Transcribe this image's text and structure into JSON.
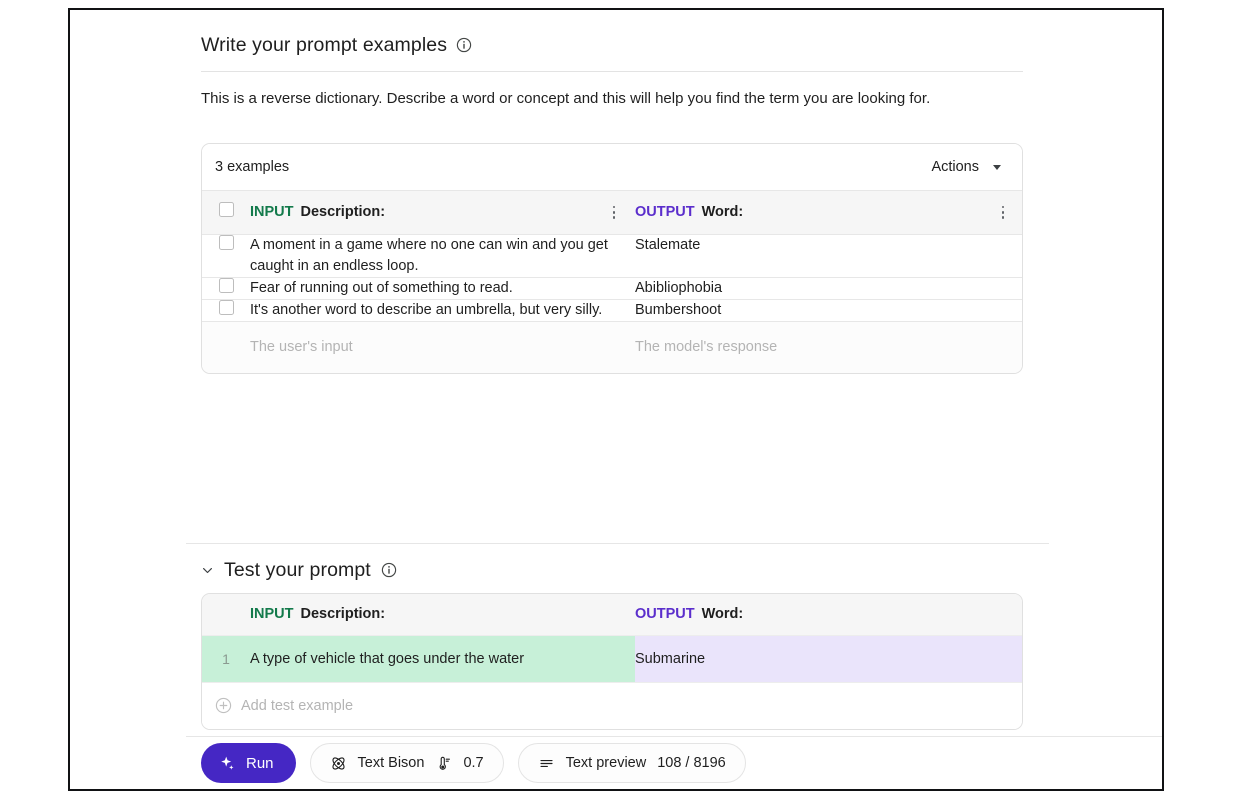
{
  "write_section": {
    "title": "Write your prompt examples",
    "info_icon": "info-icon",
    "description": "This is a reverse dictionary. Describe a word or concept and this will help you find the term you are looking for."
  },
  "examples_card": {
    "count_label": "3 examples",
    "actions_label": "Actions",
    "columns": {
      "input_tag": "INPUT",
      "input_label": "Description:",
      "output_tag": "OUTPUT",
      "output_label": "Word:"
    },
    "rows": [
      {
        "input": "A moment in a game where no one can win and you get caught in an endless loop.",
        "output": "Stalemate"
      },
      {
        "input": "Fear of running out of something to read.",
        "output": "Abibliophobia"
      },
      {
        "input": "It's another word to describe an umbrella, but very silly.",
        "output": "Bumbershoot"
      }
    ],
    "ghost_row": {
      "input_placeholder": "The user's input",
      "output_placeholder": "The model's response"
    }
  },
  "test_section": {
    "title": "Test your prompt",
    "chevron_icon": "chevron-down-icon",
    "info_icon": "info-icon",
    "columns": {
      "input_tag": "INPUT",
      "input_label": "Description:",
      "output_tag": "OUTPUT",
      "output_label": "Word:"
    },
    "rows": [
      {
        "number": "1",
        "input": "A type of vehicle that goes under the water",
        "output": "Submarine"
      }
    ],
    "add_row_label": "Add test example"
  },
  "toolbar": {
    "run_label": "Run",
    "run_icon": "sparkle-icon",
    "model_icon": "model-atom-icon",
    "model_name": "Text Bison",
    "temperature_icon": "thermometer-icon",
    "temperature_value": "0.7",
    "preview_icon": "text-lines-icon",
    "preview_label": "Text preview",
    "token_count": "108 / 8196"
  },
  "colors": {
    "input_tag": "#137a4b",
    "output_tag": "#5b2ecc",
    "run_button": "#4527c4",
    "test_input_cell": "#c7f0d8",
    "test_output_cell": "#eae4fb"
  }
}
